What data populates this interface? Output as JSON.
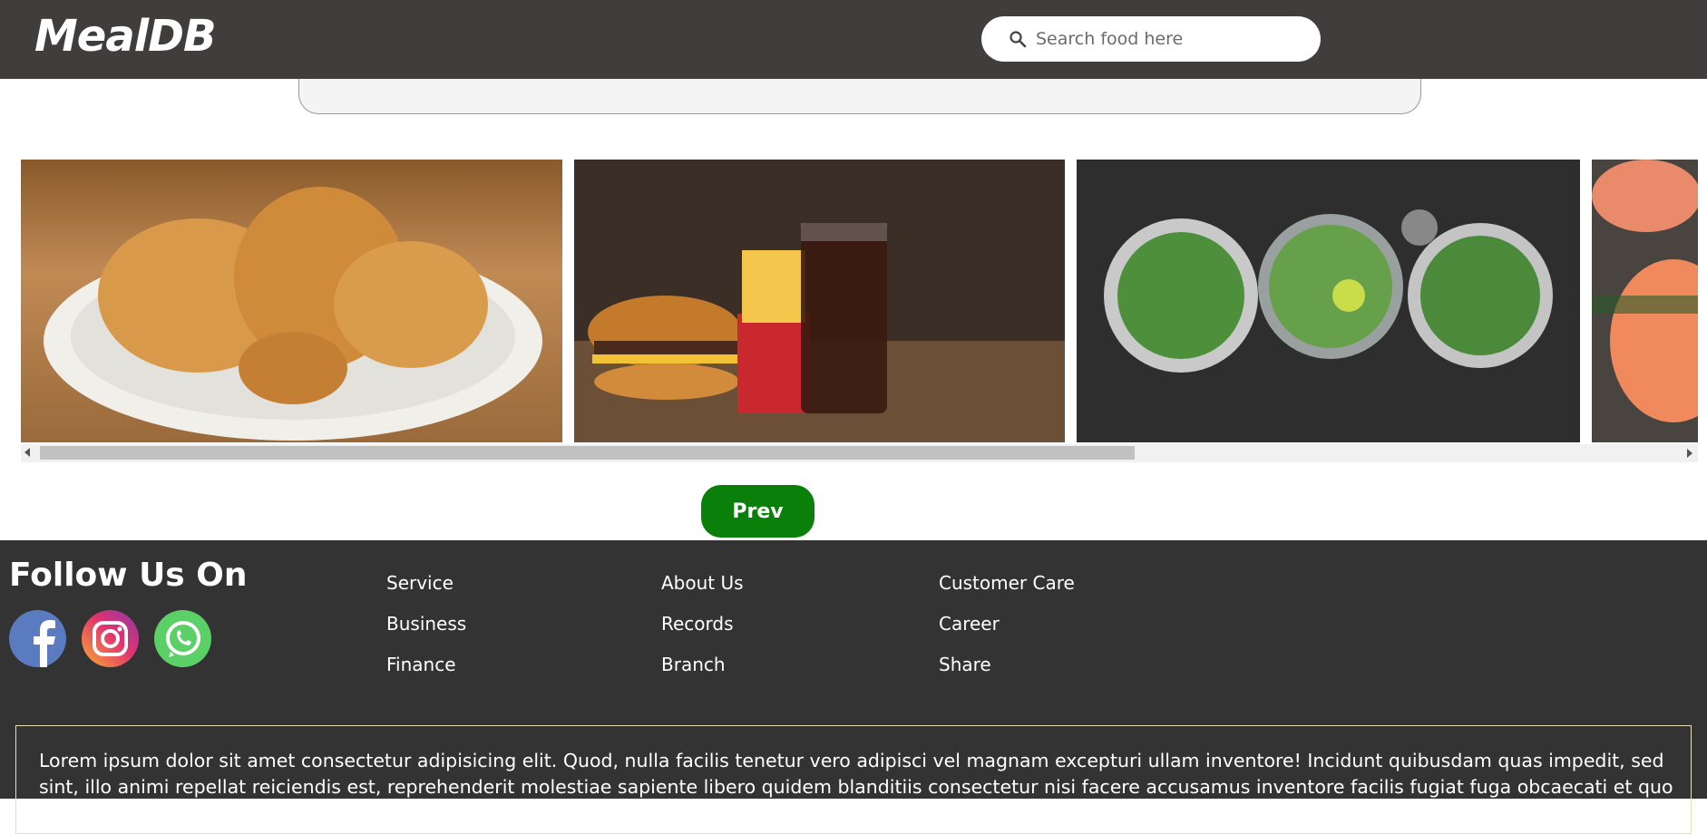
{
  "header": {
    "logo": "MealDB",
    "search": {
      "placeholder": "Search food here",
      "value": "",
      "icon": "search-icon"
    }
  },
  "gallery": {
    "images": [
      {
        "subject": "fried chicken"
      },
      {
        "subject": "burger fries and cola"
      },
      {
        "subject": "salad bowls"
      },
      {
        "subject": "salmon"
      }
    ]
  },
  "pager": {
    "prev_label": "Prev"
  },
  "footer": {
    "follow_title": "Follow Us On",
    "social": [
      "facebook-icon",
      "instagram-icon",
      "whatsapp-icon"
    ],
    "columns": [
      [
        "Service",
        "Business",
        "Finance"
      ],
      [
        "About Us",
        "Records",
        "Branch"
      ],
      [
        "Customer Care",
        "Career",
        "Share"
      ]
    ],
    "lorem": "Lorem ipsum dolor sit amet consectetur adipisicing elit. Quod, nulla facilis tenetur vero adipisci vel magnam excepturi ullam inventore! Incidunt quibusdam quas impedit, sed sint, illo animi repellat reiciendis est, reprehenderit molestiae sapiente libero quidem blanditiis consectetur nisi facere accusamus inventore facilis fugiat fuga obcaecati et quo minima."
  },
  "colors": {
    "header_bg": "#413d3d",
    "footer_bg": "#333333",
    "prev_button": "#0a7f0a"
  }
}
